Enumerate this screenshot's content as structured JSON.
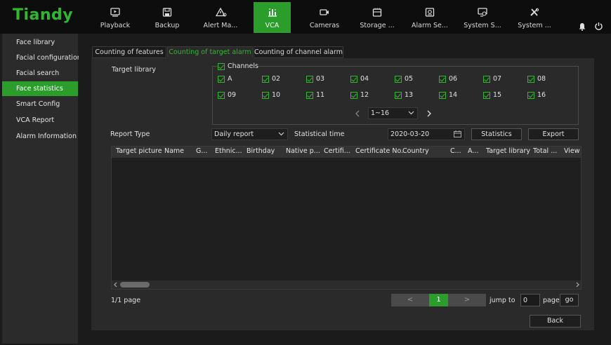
{
  "app": {
    "logo": "Tiandy"
  },
  "nav": [
    {
      "label": "Playback",
      "icon": "playback-icon"
    },
    {
      "label": "Backup",
      "icon": "save-icon"
    },
    {
      "label": "Alert Ma...",
      "icon": "alert-icon"
    },
    {
      "label": "VCA",
      "icon": "vca-chart-icon",
      "active": true
    },
    {
      "label": "Cameras",
      "icon": "camera-icon"
    },
    {
      "label": "Storage ...",
      "icon": "storage-icon"
    },
    {
      "label": "Alarm Se...",
      "icon": "alarm-settings-icon"
    },
    {
      "label": "System S...",
      "icon": "system-settings-icon"
    },
    {
      "label": "System ...",
      "icon": "tools-icon"
    }
  ],
  "sidebar": [
    {
      "label": "Face library"
    },
    {
      "label": "Facial configuration"
    },
    {
      "label": "Facial search"
    },
    {
      "label": "Face statistics",
      "active": true
    },
    {
      "label": "Smart Config"
    },
    {
      "label": "VCA Report"
    },
    {
      "label": "Alarm Information"
    }
  ],
  "tabs": [
    {
      "label": "Counting of features"
    },
    {
      "label": "Counting of target alarm",
      "active": true
    },
    {
      "label": "Counting of channel alarm"
    }
  ],
  "form": {
    "target_library_label": "Target library",
    "channels_label": "Channels",
    "channels_row1": [
      "A",
      "02",
      "03",
      "04",
      "05",
      "06",
      "07",
      "08"
    ],
    "channels_row2": [
      "09",
      "10",
      "11",
      "12",
      "13",
      "14",
      "15",
      "16"
    ],
    "channel_page": "1~16",
    "report_type_label": "Report Type",
    "report_type_value": "Daily report",
    "statistical_time_label": "Statistical time",
    "date_value": "2020-03-20",
    "statistics_button": "Statistics",
    "export_button": "Export"
  },
  "table": {
    "columns": [
      "Target picture",
      "Name",
      "G...",
      "Ethnic...",
      "Birthday",
      "Native p...",
      "Certifi...",
      "Certificate No.",
      "Country",
      "C...",
      "A...",
      "Target library",
      "Total ...",
      "View"
    ]
  },
  "pagination": {
    "page_info": "1/1 page",
    "prev": "<",
    "current": "1",
    "next": ">",
    "jump_to_label": "jump to",
    "jump_value": "0",
    "page_label": "page",
    "go_button": "go"
  },
  "back_button": "Back",
  "colors": {
    "accent": "#2a9d2a",
    "logo": "#2fb82f",
    "background": "#1b1b1b",
    "panel": "#2a2a2a"
  }
}
